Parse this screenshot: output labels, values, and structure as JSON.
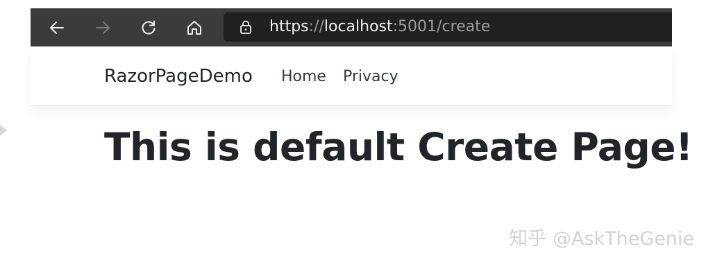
{
  "browser": {
    "url_scheme": "https",
    "url_sep": "://",
    "url_host": "localhost",
    "url_rest": ":5001/create"
  },
  "navbar": {
    "brand": "RazorPageDemo",
    "links": [
      "Home",
      "Privacy"
    ]
  },
  "main": {
    "heading": "This is default Create Page!"
  },
  "watermark": {
    "text": "知乎 @AskTheGenie"
  },
  "icons": [
    "back-icon",
    "forward-icon",
    "refresh-icon",
    "home-icon",
    "lock-icon"
  ],
  "colors": {
    "toolbar": "#3b3b3b",
    "address_bar": "#202020",
    "text_dark": "#212529"
  }
}
